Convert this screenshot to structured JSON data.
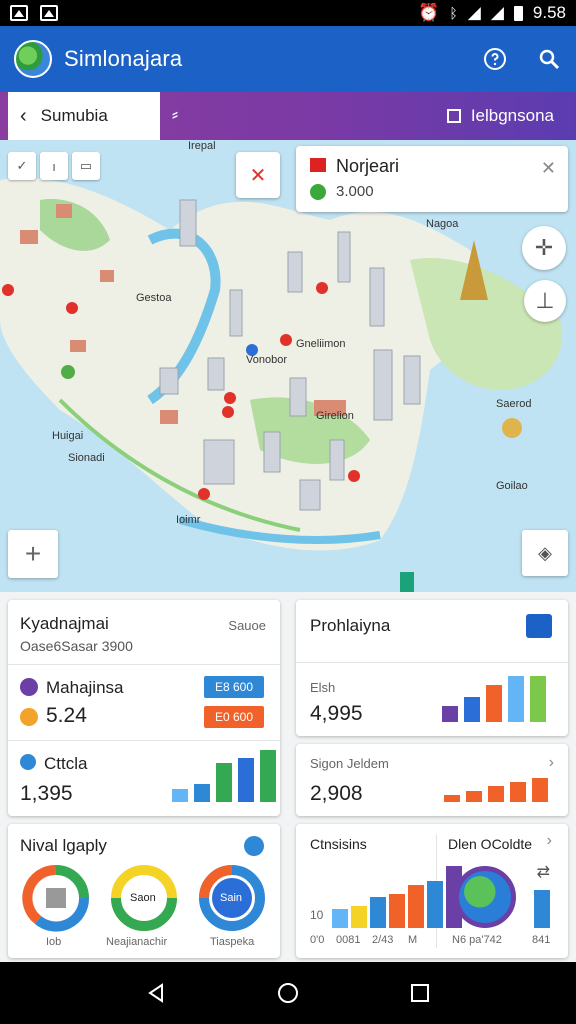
{
  "status": {
    "time": "9.58"
  },
  "app": {
    "title": "Simlonajara"
  },
  "tabs": {
    "search_label": "Sumubia",
    "right_label": "Ielbgnsona"
  },
  "map": {
    "card": {
      "name": "Norjeari",
      "value": "3.000"
    },
    "labels": [
      "Irepal",
      "Nagoa",
      "Gestoa",
      "Gneliimon",
      "Vonobor",
      "Girelion",
      "Saerod",
      "Huigai",
      "Sionadi",
      "Ioimr",
      "Goilao"
    ]
  },
  "card1": {
    "title": "Kyadnajmai",
    "subtitle": "Oase6Sasar 3900",
    "action": "Sauoe",
    "row1_label": "Mahajinsa",
    "row1_badge": "E8 600",
    "row2_value": "5.24",
    "row2_badge": "E0 600",
    "row3_label": "Cttcla",
    "row3_value": "1,395",
    "bars": [
      0.25,
      0.35,
      0.75,
      0.85,
      1.0
    ]
  },
  "card2": {
    "title": "Prohlaiyna",
    "label": "Elsh",
    "value": "4,995",
    "bars": [
      0.35,
      0.55,
      0.8,
      1.0,
      1.0
    ]
  },
  "card3": {
    "label": "Sigon  Jeldem",
    "value": "2,908",
    "bars": [
      0.3,
      0.45,
      0.65,
      0.85,
      1.0
    ]
  },
  "card4": {
    "title": "Nival lgaply",
    "donuts": [
      {
        "inner": "",
        "label": "Iob"
      },
      {
        "inner": "Saon",
        "label": "Neajianachir"
      },
      {
        "inner": "Sain",
        "label": "Tiaspeka"
      }
    ]
  },
  "card5": {
    "title": "Ctnsisins",
    "x_labels": [
      "0'0",
      "0081",
      "2/43",
      "M"
    ],
    "y_label": "10",
    "bars": [
      0.3,
      0.35,
      0.5,
      0.55,
      0.7,
      0.75,
      1.0
    ],
    "right_title": "Dlen OColdte",
    "right_labels": [
      "N6 pa'742",
      "841"
    ]
  },
  "colors": {
    "appbar": "#1c62c6",
    "tab_gradient": [
      "#8a3d9e",
      "#5b3cb0"
    ],
    "badge_blue": "#2f88d6",
    "badge_orange": "#f0622a"
  },
  "icons": [
    "globe-icon",
    "help-icon",
    "search-icon",
    "back-icon",
    "filter-icon",
    "tag-icon",
    "crosshair-icon",
    "compass-icon",
    "zoom-in-icon",
    "layers-icon",
    "bookmark-icon",
    "back-nav-icon",
    "home-nav-icon",
    "recents-nav-icon"
  ]
}
